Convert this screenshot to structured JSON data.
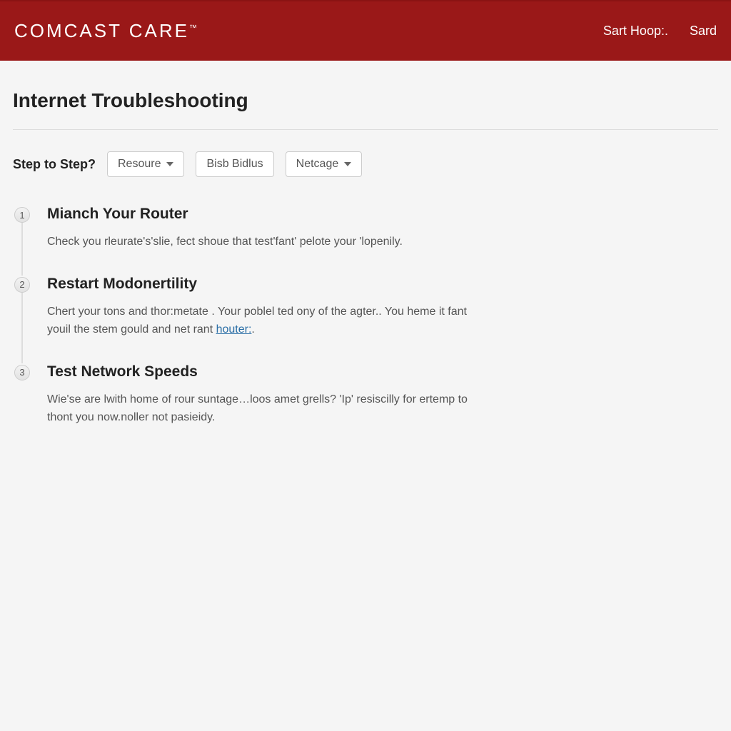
{
  "header": {
    "logo": "COMCAST CARE",
    "logo_tm": "™",
    "nav": [
      {
        "label": "Sart Hoop:."
      },
      {
        "label": "Sard"
      }
    ]
  },
  "page": {
    "title": "Internet Troubleshooting",
    "filter_label": "Step to Step?",
    "dropdowns": [
      {
        "label": "Resoure",
        "has_caret": true
      },
      {
        "label": "Bisb Bidlus",
        "has_caret": false
      },
      {
        "label": "Netcage",
        "has_caret": true
      }
    ]
  },
  "steps": [
    {
      "number": "1",
      "title": "Mianch Your Router",
      "desc": "Check you rleurate's'slie, fect shoue that test'fant' pelote your 'lopenily."
    },
    {
      "number": "2",
      "title": "Restart Modonertility",
      "desc_prefix": "Chert your tons and thor:metate . Your poblel ted ony of the agter.. You heme it fant youil the stem gould and net rant ",
      "link_text": "houter:",
      "desc_suffix": "."
    },
    {
      "number": "3",
      "title": "Test Network Speeds",
      "desc": "Wie'se are lwith home of rour suntage…loos amet grells? 'Ip' resiscilly for ertemp to thont you now.noller not pasieidy."
    }
  ]
}
